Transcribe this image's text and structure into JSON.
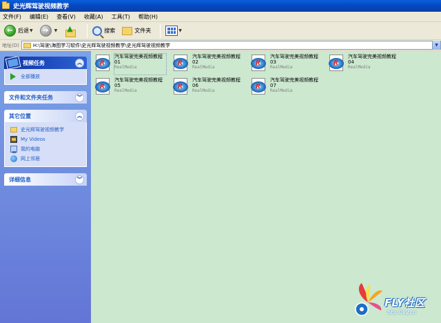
{
  "window": {
    "title": "史光辉驾驶视频教学"
  },
  "menu": [
    "文件(F)",
    "编辑(E)",
    "查看(V)",
    "收藏(A)",
    "工具(T)",
    "帮助(H)"
  ],
  "toolbar": {
    "back": "后退",
    "search": "搜索",
    "folders": "文件夹"
  },
  "address": {
    "label": "地址(D)",
    "path": "H:\\驾驶\\海图学习软件\\史光辉驾驶视频教学\\史光辉驾驶视频教学"
  },
  "tasks_panel": {
    "title": "视频任务",
    "items": [
      {
        "label": "全部播放",
        "icon": "play-icon"
      }
    ]
  },
  "file_tasks_panel": {
    "title": "文件和文件夹任务"
  },
  "other_places": {
    "title": "其它位置",
    "items": [
      {
        "label": "史光辉驾驶视频教学",
        "icon": "folder-icon"
      },
      {
        "label": "My Videos",
        "icon": "videos-icon"
      },
      {
        "label": "我的电脑",
        "icon": "computer-icon"
      },
      {
        "label": "网上邻居",
        "icon": "network-icon"
      }
    ]
  },
  "details_panel": {
    "title": "详细信息"
  },
  "files": [
    {
      "name": "汽车驾驶完美视频教程01",
      "type": "RealMedia"
    },
    {
      "name": "汽车驾驶完美视频教程02",
      "type": "RealMedia"
    },
    {
      "name": "汽车驾驶完美视频教程03",
      "type": "RealMedia"
    },
    {
      "name": "汽车驾驶完美视频教程04",
      "type": "RealMedia"
    },
    {
      "name": "汽车驾驶完美视频教程05",
      "type": "RealMedia"
    },
    {
      "name": "汽车驾驶完美视频教程06",
      "type": "RealMedia"
    },
    {
      "name": "汽车驾驶完美视频教程07",
      "type": "RealMedia"
    }
  ],
  "watermark": {
    "brand": "FLY社区",
    "url": "bbs.0xy.cn"
  },
  "colors": {
    "titlebar": "#0A5FDC",
    "sidepane": "#7BA2E7",
    "content_bg": "#CCE8CF",
    "link": "#215DC6"
  }
}
